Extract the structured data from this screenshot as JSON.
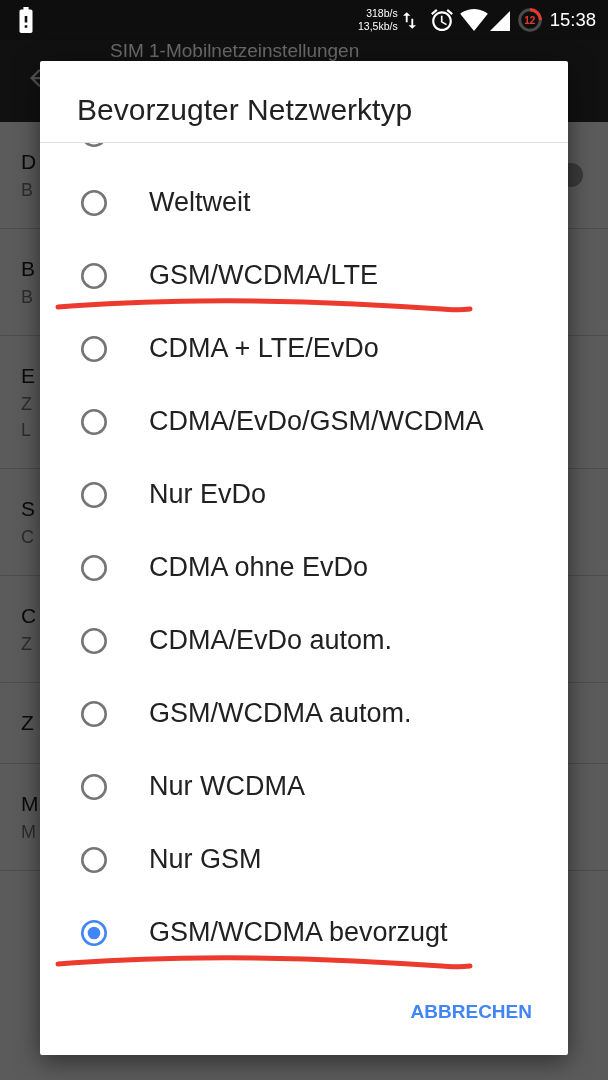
{
  "status_bar": {
    "speed_up": "318b/s",
    "speed_down": "13,5kb/s",
    "data_usage": "12",
    "time": "15:38"
  },
  "app_bar": {
    "title": "SIM 1-Mobilnetzeinstellungen"
  },
  "settings_list": [
    {
      "title": "D",
      "summary": [
        "B"
      ],
      "switch": true
    },
    {
      "title": "B",
      "summary": [
        "B"
      ]
    },
    {
      "title": "E",
      "summary": [
        "Z",
        "L"
      ]
    },
    {
      "title": "S",
      "summary": [
        "C"
      ]
    },
    {
      "title": "C",
      "summary": [
        "Z"
      ]
    },
    {
      "title": "Z"
    },
    {
      "title": "M",
      "summary": [
        "M"
      ]
    }
  ],
  "dialog": {
    "title": "Bevorzugter Netzwerktyp",
    "options": [
      {
        "label": "Weltweit",
        "selected": false,
        "underlined": false
      },
      {
        "label": "GSM/WCDMA/LTE",
        "selected": false,
        "underlined": true
      },
      {
        "label": "CDMA + LTE/EvDo",
        "selected": false,
        "underlined": false
      },
      {
        "label": "CDMA/EvDo/GSM/WCDMA",
        "selected": false,
        "underlined": false
      },
      {
        "label": "Nur EvDo",
        "selected": false,
        "underlined": false
      },
      {
        "label": "CDMA ohne EvDo",
        "selected": false,
        "underlined": false
      },
      {
        "label": "CDMA/EvDo autom.",
        "selected": false,
        "underlined": false
      },
      {
        "label": "GSM/WCDMA autom.",
        "selected": false,
        "underlined": false
      },
      {
        "label": "Nur WCDMA",
        "selected": false,
        "underlined": false
      },
      {
        "label": "Nur GSM",
        "selected": false,
        "underlined": false
      },
      {
        "label": "GSM/WCDMA bevorzugt",
        "selected": true,
        "underlined": true
      }
    ],
    "buttons": [
      "ABBRECHEN"
    ]
  }
}
